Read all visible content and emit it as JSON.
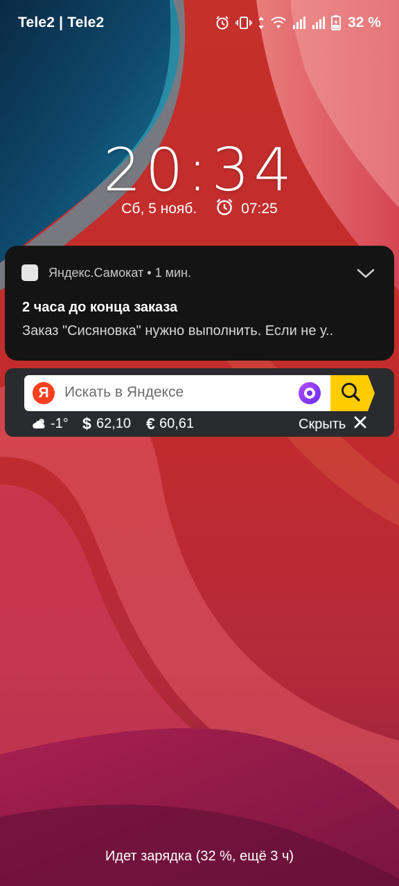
{
  "status_bar": {
    "carrier": "Tele2 | Tele2",
    "battery_percent": "32 %",
    "icons": [
      "alarm-icon",
      "vibrate-icon",
      "data-arrows-icon",
      "wifi-icon",
      "signal-icon",
      "signal-icon",
      "battery-icon"
    ]
  },
  "lockscreen": {
    "time": "20:34",
    "date": "Сб, 5 нояб.",
    "alarm_time": "07:25"
  },
  "notification": {
    "app_name": "Яндекс.Самокат",
    "separator": "•",
    "time_ago": "1 мин.",
    "title": "2 часа до конца заказа",
    "text": "Заказ \"Сисяновка\" нужно выполнить. Если не у.."
  },
  "widget": {
    "logo_letter": "Я",
    "search_placeholder": "Искать в Яндексе",
    "temperature": "-1°",
    "usd_symbol": "$",
    "usd_rate": "62,10",
    "eur_symbol": "€",
    "eur_rate": "60,61",
    "hide_label": "Скрыть"
  },
  "charging_text": "Идет зарядка (32 %, ещё 3 ч)",
  "colors": {
    "notification_bg": "#141414",
    "widget_bg": "#2a2b2e",
    "yandex_red": "#fc3f1d",
    "search_yellow": "#ffcc00",
    "alice_purple": "#7b2ff7"
  }
}
